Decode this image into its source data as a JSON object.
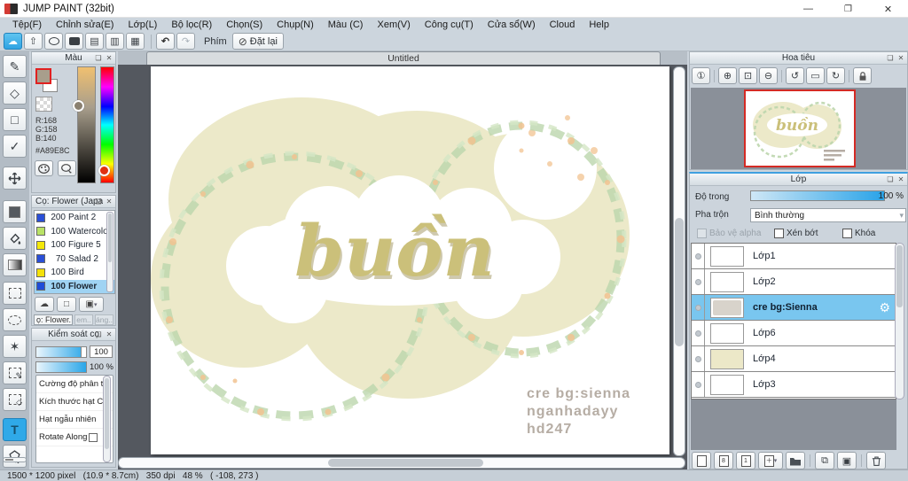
{
  "window": {
    "title": "JUMP PAINT (32bit)"
  },
  "menu": {
    "items": [
      "Tệp(F)",
      "Chỉnh sửa(E)",
      "Lớp(L)",
      "Bộ lọc(R)",
      "Chọn(S)",
      "Chụp(N)",
      "Màu (C)",
      "Xem(V)",
      "Công cụ(T)",
      "Cửa sổ(W)",
      "Cloud",
      "Help"
    ]
  },
  "toolbar": {
    "phim_label": "Phím",
    "reset_label": "Đặt lại"
  },
  "canvas": {
    "tab": "Untitled",
    "art_title": "buồn",
    "credits": [
      "cre bg:sienna",
      "nganhadayy",
      "hd247"
    ]
  },
  "color_panel": {
    "title": "Màu",
    "r": "R:168",
    "g": "G:158",
    "b": "B:140",
    "hex": "#A89E8C",
    "fg_color": "#A89E8C"
  },
  "brush_panel": {
    "title": "Cọ: Flower (Japa...",
    "footer_name": "ọ: Flower.",
    "footer_buttons": [
      "em..",
      "áng.."
    ],
    "brushes": [
      {
        "size": "200",
        "name": "Paint 2",
        "swatch": "#2a4fd7"
      },
      {
        "size": "100",
        "name": "Watercolo",
        "swatch": "#b9e266"
      },
      {
        "size": "100",
        "name": "Figure 5",
        "swatch": "#f4e80a"
      },
      {
        "size": "70",
        "name": "Salad 2",
        "swatch": "#2a4fd7"
      },
      {
        "size": "100",
        "name": "Bird",
        "swatch": "#f4e10a"
      },
      {
        "size": "100",
        "name": "Flower",
        "swatch": "#1e4cd8"
      }
    ]
  },
  "brush_control": {
    "title": "Kiểm soát cọ",
    "value1": "100",
    "value2": "100 %",
    "options": [
      "Cường độ phân t",
      "Kích thước hạt C",
      "Hạt ngẫu nhiên",
      "Rotate Along"
    ]
  },
  "navigator": {
    "title": "Hoa tiêu"
  },
  "layers_panel": {
    "title": "Lớp",
    "opacity_label": "Độ trong",
    "opacity_value": "100 %",
    "blend_label": "Pha trộn",
    "blend_value": "Bình thường",
    "checkboxes": [
      "Bảo vệ alpha",
      "Xén bớt",
      "Khóa"
    ],
    "layers": [
      {
        "name": "Lớp1"
      },
      {
        "name": "Lớp2"
      },
      {
        "name": "cre bg:Sienna",
        "selected": true
      },
      {
        "name": "Lớp6"
      },
      {
        "name": "Lớp4"
      },
      {
        "name": "Lớp3"
      }
    ]
  },
  "status_bar": {
    "text": "1500 * 1200 pixel   (10.9 * 8.7cm)   350 dpi   48 %   ( -108, 273 )"
  },
  "colors": {
    "accent": "#29a3e8",
    "selection": "#79c6ef",
    "art_beige": "#ece9c9",
    "art_green": "#bcd6ad",
    "art_orange": "#f2c391",
    "art_text": "#c9be78"
  }
}
